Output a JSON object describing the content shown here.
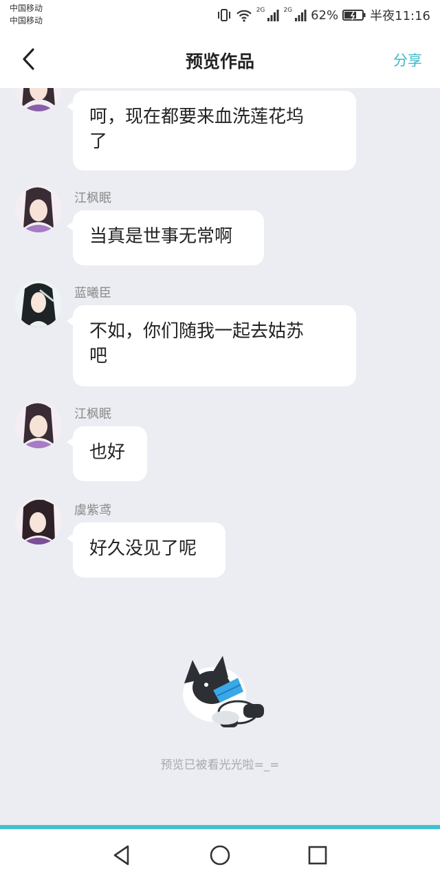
{
  "status_bar": {
    "carrier_1": "中国移动",
    "carrier_2": "中国移动",
    "net_1": "2G",
    "net_2": "2G",
    "battery": "62%",
    "time": "半夜11:16"
  },
  "header": {
    "title": "预览作品",
    "share": "分享"
  },
  "messages": [
    {
      "sender": "",
      "text": "呵，现在都要来血洗莲花坞了",
      "line1": "呵，现在都要来血洗莲花坞",
      "line2": "了"
    },
    {
      "sender": "江枫眠",
      "text": "当真是世事无常啊"
    },
    {
      "sender": "蓝曦臣",
      "text": "不如，你们随我一起去姑苏吧",
      "line1": "不如，你们随我一起去姑苏",
      "line2": "吧"
    },
    {
      "sender": "江枫眠",
      "text": "也好"
    },
    {
      "sender": "虞紫鸢",
      "text": "好久没见了呢"
    }
  ],
  "footer_note": "预览已被看光光啦=_=",
  "colors": {
    "accent": "#3bb8c9",
    "nav_line": "#42c1cf",
    "background": "#ebedf2"
  },
  "icons": [
    "vibrate-icon",
    "wifi-icon",
    "signal-icon",
    "battery-icon",
    "back-arrow-icon",
    "nav-back-icon",
    "nav-home-icon",
    "nav-recents-icon"
  ]
}
